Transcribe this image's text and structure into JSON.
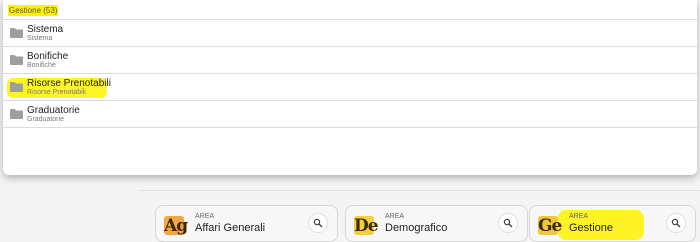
{
  "dropdown": {
    "header": "Gestione (53)",
    "items": [
      {
        "name": "Sistema",
        "sub": "Sistema"
      },
      {
        "name": "Bonifiche",
        "sub": "Bonifiche"
      },
      {
        "name": "Risorse Prenotabili",
        "sub": "Risorse Prenotabili"
      },
      {
        "name": "Graduatorie",
        "sub": "Graduatorie"
      }
    ]
  },
  "areas": [
    {
      "logo": "Ag",
      "eyebrow": "AREA",
      "label": "Affari Generali",
      "logo_color": "#f4a640"
    },
    {
      "logo": "De",
      "eyebrow": "AREA",
      "label": "Demografico",
      "logo_color": "#f4cf3a"
    },
    {
      "logo": "Ge",
      "eyebrow": "AREA",
      "label": "Gestione",
      "logo_color": "#f0c63a"
    }
  ],
  "colors": {
    "highlight": "#fff200",
    "folder": "#9e9e9e"
  },
  "icons": {
    "folder": "folder-icon",
    "search": "search-icon"
  }
}
